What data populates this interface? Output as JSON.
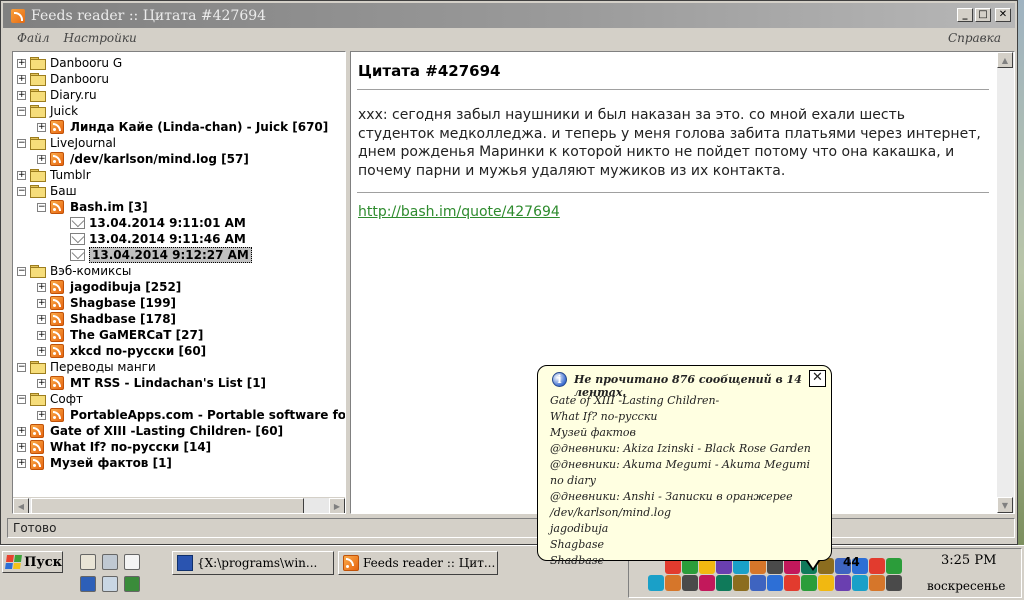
{
  "window": {
    "title": "Feeds reader :: Цитата #427694",
    "buttons": {
      "minimize": "_",
      "maximize": "□",
      "close": "✕"
    }
  },
  "menu": {
    "file": "Файл",
    "settings": "Настройки",
    "help": "Справка"
  },
  "tree": {
    "nodes": [
      {
        "label": "Danbooru G",
        "type": "folder",
        "level": 0,
        "expander": "+"
      },
      {
        "label": "Danbooru",
        "type": "folder",
        "level": 0,
        "expander": "+"
      },
      {
        "label": "Diary.ru",
        "type": "folder",
        "level": 0,
        "expander": "+"
      },
      {
        "label": "Juick",
        "type": "folder",
        "level": 0,
        "expander": "−"
      },
      {
        "label": "Линда Кайе (Linda-chan) - Juick [670]",
        "type": "feed",
        "level": 1,
        "expander": "+",
        "bold": true
      },
      {
        "label": "LiveJournal",
        "type": "folder",
        "level": 0,
        "expander": "−"
      },
      {
        "label": "/dev/karlson/mind.log [57]",
        "type": "feed",
        "level": 1,
        "expander": "+",
        "bold": true
      },
      {
        "label": "Tumblr",
        "type": "folder",
        "level": 0,
        "expander": "+"
      },
      {
        "label": "Баш",
        "type": "folder",
        "level": 0,
        "expander": "−"
      },
      {
        "label": "Bash.im [3]",
        "type": "feed",
        "level": 1,
        "expander": "−",
        "bold": true
      },
      {
        "label": "13.04.2014 9:11:01 AM",
        "type": "item",
        "level": 2,
        "bold": true
      },
      {
        "label": "13.04.2014 9:11:46 AM",
        "type": "item",
        "level": 2,
        "bold": true
      },
      {
        "label": "13.04.2014 9:12:27 AM",
        "type": "item",
        "level": 2,
        "bold": true,
        "selected": true
      },
      {
        "label": "Вэб-комиксы",
        "type": "folder",
        "level": 0,
        "expander": "−"
      },
      {
        "label": "jagodibuja [252]",
        "type": "feed",
        "level": 1,
        "expander": "+",
        "bold": true
      },
      {
        "label": "Shagbase [199]",
        "type": "feed",
        "level": 1,
        "expander": "+",
        "bold": true
      },
      {
        "label": "Shadbase [178]",
        "type": "feed",
        "level": 1,
        "expander": "+",
        "bold": true
      },
      {
        "label": "The GaMERCaT [27]",
        "type": "feed",
        "level": 1,
        "expander": "+",
        "bold": true
      },
      {
        "label": "xkcd по-русски [60]",
        "type": "feed",
        "level": 1,
        "expander": "+",
        "bold": true
      },
      {
        "label": "Переводы манги",
        "type": "folder",
        "level": 0,
        "expander": "−"
      },
      {
        "label": "MT RSS - Lindachan's List [1]",
        "type": "feed",
        "level": 1,
        "expander": "+",
        "bold": true
      },
      {
        "label": "Софт",
        "type": "folder",
        "level": 0,
        "expander": "−"
      },
      {
        "label": "PortableApps.com - Portable software for U",
        "type": "feed",
        "level": 1,
        "expander": "+",
        "bold": true
      },
      {
        "label": "Gate of XIII -Lasting Children- [60]",
        "type": "feed",
        "level": 0,
        "expander": "+",
        "bold": true
      },
      {
        "label": "What If? по-русски [14]",
        "type": "feed",
        "level": 0,
        "expander": "+",
        "bold": true
      },
      {
        "label": "Музей фактов [1]",
        "type": "feed",
        "level": 0,
        "expander": "+",
        "bold": true
      }
    ]
  },
  "article": {
    "title": "Цитата #427694",
    "body": "xxx: сегодня забыл наушники и был наказан за это. со мной ехали шесть студенток медколледжа. и теперь у меня голова забита платьями через интернет, днем рожденья Маринки к которой никто не пойдет потому что она какашка, и почему парни и мужья удаляют мужиков из их контакта.",
    "link": "http://bash.im/quote/427694"
  },
  "status": {
    "text": "Готово"
  },
  "notification": {
    "title": "Не прочитано 876 сообщений в 14 лентах.",
    "lines": [
      "Gate of XIII -Lasting Children-",
      "What If? по-русски",
      "Музей фактов",
      "@дневники: Akiza Izinski - Black Rose Garden",
      "@дневники: Akuma Megumi - Akuma Megumi no diary",
      "@дневники: Anshi - Записки в оранжерее",
      "/dev/karlson/mind.log",
      "jagodibuja",
      "Shagbase",
      "Shadbase"
    ],
    "close": "✕"
  },
  "taskbar": {
    "start": "Пуск",
    "tasks": [
      {
        "label": "{X:\\programs\\win...",
        "icon": "window-icon"
      },
      {
        "label": "Feeds reader :: Цит...",
        "icon": "rss-icon"
      }
    ],
    "tray_badge": "44",
    "clock_time": "3:25 PM",
    "clock_day": "воскресенье"
  },
  "colors": {
    "link": "#2e8b2e",
    "rss": "#e6640f",
    "balloon_bg": "#ffffe1",
    "face": "#d4d0c8"
  }
}
